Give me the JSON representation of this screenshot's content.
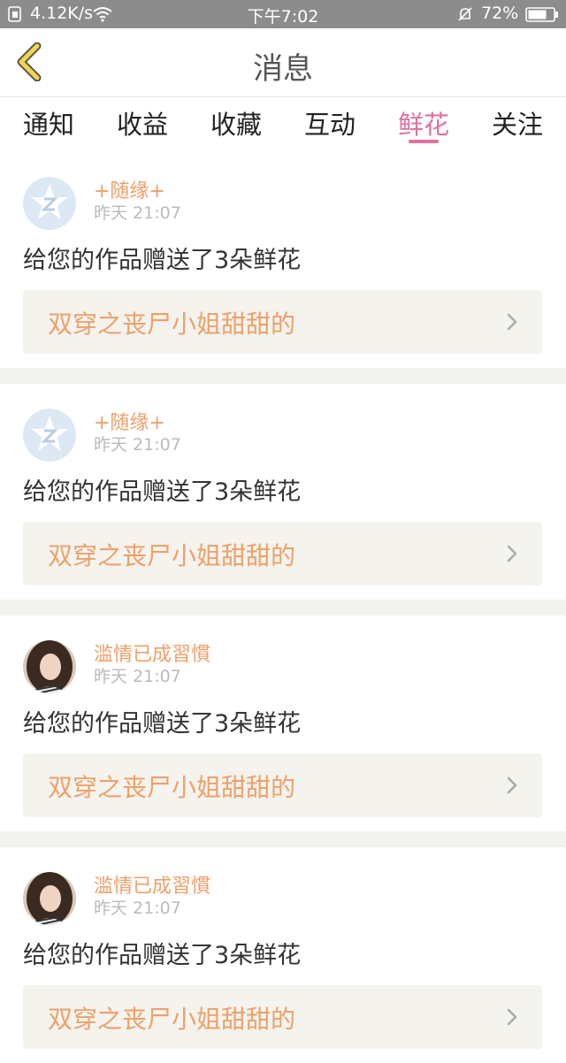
{
  "status": {
    "speed": "4.12K/s",
    "time": "下午7:02",
    "battery": "72%"
  },
  "header": {
    "title": "消息"
  },
  "tabs": [
    {
      "label": "通知",
      "active": false
    },
    {
      "label": "收益",
      "active": false
    },
    {
      "label": "收藏",
      "active": false
    },
    {
      "label": "互动",
      "active": false
    },
    {
      "label": "鲜花",
      "active": true
    },
    {
      "label": "关注",
      "active": false
    }
  ],
  "accent_color": "#e0709f",
  "name_color": "#f0a06a",
  "messages": [
    {
      "user": "+随缘+",
      "time": "昨天 21:07",
      "text": "给您的作品赠送了3朵鲜花",
      "work": "双穿之丧尸小姐甜甜的",
      "avatar": "default-star-avatar"
    },
    {
      "user": "+随缘+",
      "time": "昨天 21:07",
      "text": "给您的作品赠送了3朵鲜花",
      "work": "双穿之丧尸小姐甜甜的",
      "avatar": "default-star-avatar"
    },
    {
      "user": "滥情已成習慣",
      "time": "昨天 21:07",
      "text": "给您的作品赠送了3朵鲜花",
      "work": "双穿之丧尸小姐甜甜的",
      "avatar": "photo-avatar"
    },
    {
      "user": "滥情已成習慣",
      "time": "昨天 21:07",
      "text": "给您的作品赠送了3朵鲜花",
      "work": "双穿之丧尸小姐甜甜的",
      "avatar": "photo-avatar"
    }
  ]
}
